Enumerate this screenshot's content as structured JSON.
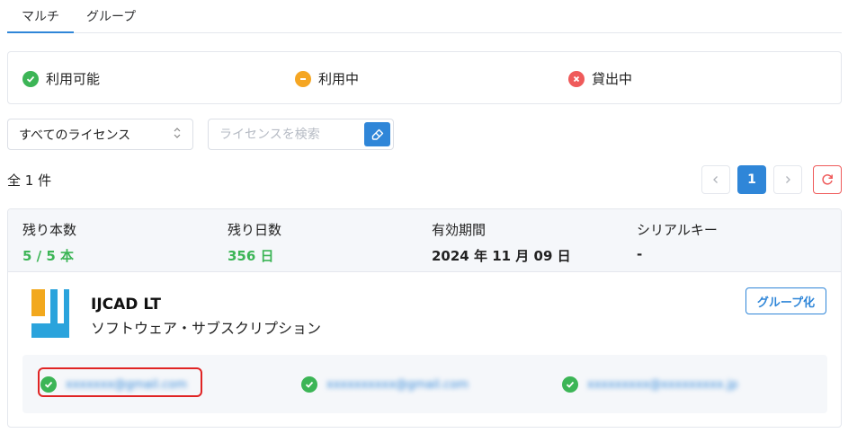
{
  "tabs": [
    {
      "label": "マルチ",
      "active": true
    },
    {
      "label": "グループ",
      "active": false
    }
  ],
  "legend": [
    {
      "label": "利用可能",
      "color": "#3cb556",
      "icon": "check-circle-icon"
    },
    {
      "label": "利用中",
      "color": "#f5a623",
      "icon": "minus-circle-icon"
    },
    {
      "label": "貸出中",
      "color": "#ef5a5a",
      "icon": "x-circle-icon"
    }
  ],
  "filters": {
    "select_value": "すべてのライセンス",
    "search_placeholder": "ライセンスを検索"
  },
  "count_text": "全 1 件",
  "pagination": {
    "current": "1"
  },
  "license": {
    "stats": [
      {
        "label": "残り本数",
        "value": "5 / 5 本"
      },
      {
        "label": "残り日数",
        "value": "356 日"
      },
      {
        "label": "有効期間",
        "value": "2024 年 11 月 09 日"
      },
      {
        "label": "シリアルキー",
        "value": "-"
      }
    ],
    "product_name": "IJCAD LT",
    "product_type": "ソフトウェア・サブスクリプション",
    "group_button": "グループ化",
    "users": [
      {
        "email": "xxxxxxx@gmail.com"
      },
      {
        "email": "xxxxxxxxxx@gmail.com"
      },
      {
        "email": "xxxxxxxxx@xxxxxxxxx.jp"
      }
    ]
  },
  "colors": {
    "accent": "#2f86d8",
    "available": "#3cb556",
    "in_use": "#f5a623",
    "lent": "#ef5a5a"
  }
}
